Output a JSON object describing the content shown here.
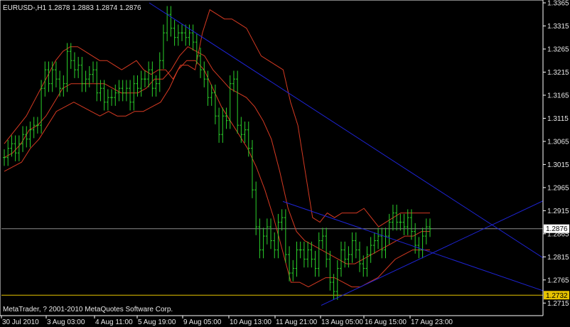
{
  "window": {
    "symbol_info": "EURUSD-,H1  1.2878  1.2883  1.2874  1.2876",
    "copyright": "MetaTrader, ? 2001-2010 MetaQuotes Software Corp."
  },
  "colors": {
    "background": "#000000",
    "frame": "#ffffff",
    "bull_bar": "#2bd12b",
    "bear_bar": "#2bd12b",
    "bands": "#d53a22",
    "trendlines": "#1e24d6",
    "bid_line": "#8a8a8a",
    "ask_line": "#e6c200",
    "axis_text": "#e8e8e8",
    "price_label_bg": "#e6c200"
  },
  "chart_data": {
    "type": "line",
    "timeframe": "H1",
    "ylim": [
      1.2697,
      1.3365
    ],
    "y_ticks": [
      "1.3365",
      "1.3315",
      "1.3265",
      "1.3215",
      "1.3165",
      "1.3115",
      "1.3065",
      "1.3015",
      "1.2965",
      "1.2915",
      "1.2865",
      "1.2815",
      "1.2765",
      "1.2715"
    ],
    "x_ticks": [
      "30 Jul 2010",
      "3 Aug 03:00",
      "4 Aug 11:00",
      "5 Aug 19:00",
      "9 Aug 05:00",
      "10 Aug 13:00",
      "11 Aug 21:00",
      "13 Aug 05:00",
      "16 Aug 15:00",
      "17 Aug 23:00"
    ],
    "current_price": "1.2876",
    "ask_price": "1.2732",
    "series": [
      {
        "kind": "close_bars",
        "values": [
          1.303,
          1.305,
          1.306,
          1.304,
          1.306,
          1.308,
          1.307,
          1.309,
          1.31,
          1.31,
          1.318,
          1.322,
          1.319,
          1.322,
          1.32,
          1.318,
          1.319,
          1.326,
          1.324,
          1.322,
          1.323,
          1.319,
          1.32,
          1.321,
          1.322,
          1.317,
          1.318,
          1.315,
          1.316,
          1.316,
          1.317,
          1.318,
          1.317,
          1.318,
          1.315,
          1.319,
          1.318,
          1.32,
          1.32,
          1.322,
          1.318,
          1.319,
          1.324,
          1.33,
          1.334,
          1.331,
          1.329,
          1.33,
          1.33,
          1.329,
          1.33,
          1.328,
          1.325,
          1.322,
          1.32,
          1.316,
          1.317,
          1.312,
          1.308,
          1.312,
          1.311,
          1.319,
          1.32,
          1.31,
          1.308,
          1.309,
          1.305,
          1.296,
          1.288,
          1.283,
          1.286,
          1.288,
          1.285,
          1.283,
          1.289,
          1.29,
          1.282,
          1.278,
          1.279,
          1.283,
          1.283,
          1.281,
          1.283,
          1.281,
          1.279,
          1.285,
          1.286,
          1.281,
          1.276,
          1.274,
          1.279,
          1.283,
          1.281,
          1.282,
          1.285,
          1.283,
          1.28,
          1.279,
          1.282,
          1.284,
          1.285,
          1.286,
          1.283,
          1.286,
          1.289,
          1.291,
          1.289,
          1.289,
          1.288,
          1.29,
          1.287,
          1.284,
          1.283,
          1.286,
          1.288,
          1.2876
        ]
      },
      {
        "kind": "upper_band",
        "values": [
          1.306,
          1.308,
          1.31,
          1.312,
          1.315,
          1.318,
          1.321,
          1.324,
          1.326,
          1.327,
          1.327,
          1.326,
          1.325,
          1.324,
          1.324,
          1.323,
          1.322,
          1.323,
          1.324,
          1.322,
          1.321,
          1.322,
          1.322,
          1.32,
          1.323,
          1.323,
          1.322,
          1.33,
          1.335,
          1.334,
          1.333,
          1.333,
          1.332,
          1.331,
          1.328,
          1.325,
          1.324,
          1.323,
          1.322,
          1.315,
          1.31,
          1.3,
          1.29,
          1.289,
          1.291,
          1.29,
          1.291,
          1.291,
          1.291,
          1.292,
          1.29,
          1.288,
          1.289,
          1.29,
          1.291,
          1.291,
          1.291,
          1.291,
          1.291
        ]
      },
      {
        "kind": "middle_band",
        "values": [
          1.303,
          1.304,
          1.306,
          1.309,
          1.31,
          1.312,
          1.315,
          1.318,
          1.319,
          1.319,
          1.319,
          1.319,
          1.319,
          1.318,
          1.317,
          1.317,
          1.317,
          1.318,
          1.32,
          1.32,
          1.322,
          1.325,
          1.327,
          1.326,
          1.325,
          1.322,
          1.32,
          1.318,
          1.317,
          1.316,
          1.314,
          1.311,
          1.307,
          1.3,
          1.292,
          1.287,
          1.285,
          1.284,
          1.283,
          1.282,
          1.281,
          1.28,
          1.28,
          1.281,
          1.282,
          1.283,
          1.284,
          1.285,
          1.286,
          1.286,
          1.287,
          1.287
        ]
      },
      {
        "kind": "lower_band",
        "values": [
          1.3,
          1.301,
          1.302,
          1.305,
          1.307,
          1.31,
          1.313,
          1.314,
          1.315,
          1.314,
          1.313,
          1.312,
          1.313,
          1.312,
          1.312,
          1.313,
          1.313,
          1.314,
          1.315,
          1.318,
          1.322,
          1.324,
          1.324,
          1.322,
          1.318,
          1.314,
          1.311,
          1.308,
          1.305,
          1.301,
          1.296,
          1.29,
          1.283,
          1.276,
          1.276,
          1.275,
          1.276,
          1.277,
          1.277,
          1.276,
          1.275,
          1.275,
          1.276,
          1.277,
          1.279,
          1.281,
          1.282,
          1.283,
          1.283,
          1.283
        ]
      }
    ],
    "trendlines": [
      {
        "from": [
          "first",
          1.3365
        ],
        "to": [
          "end",
          1.2787
        ]
      },
      {
        "from": [
          "mid",
          1.2935
        ],
        "to": [
          "end",
          1.2728
        ]
      },
      {
        "from": [
          "late",
          1.271
        ],
        "to": [
          "end",
          1.2955
        ]
      }
    ]
  }
}
